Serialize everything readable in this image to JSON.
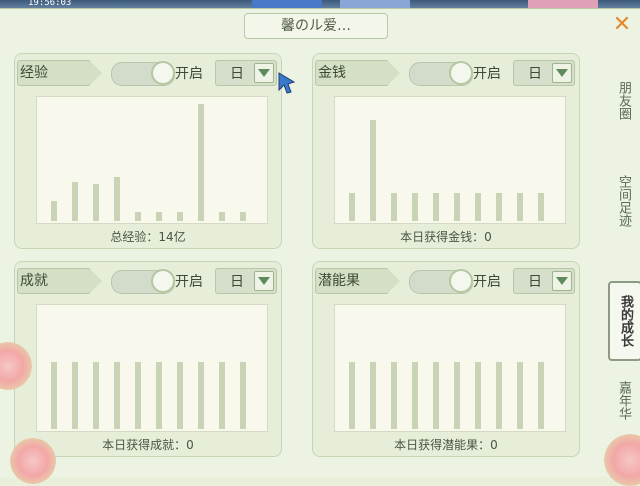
{
  "topbar": {
    "clock": "19:56:03"
  },
  "window": {
    "title": "馨のル爱…",
    "close": "✕"
  },
  "panels": [
    {
      "id": "exp",
      "label": "经验",
      "toggle": "开启",
      "select": "日",
      "summary": "总经验：14亿",
      "bars": [
        0.16,
        0.32,
        0.3,
        0.36,
        0.07,
        0.07,
        0.07,
        0.96,
        0.07,
        0.07
      ]
    },
    {
      "id": "money",
      "label": "金钱",
      "toggle": "开启",
      "select": "日",
      "summary": "本日获得金钱：0",
      "bars": [
        0.23,
        0.83,
        0.23,
        0.23,
        0.23,
        0.23,
        0.23,
        0.23,
        0.23,
        0.23
      ]
    },
    {
      "id": "achievement",
      "label": "成就",
      "toggle": "开启",
      "select": "日",
      "summary": "本日获得成就：0",
      "bars": [
        0.55,
        0.55,
        0.55,
        0.55,
        0.55,
        0.55,
        0.55,
        0.55,
        0.55,
        0.55
      ]
    },
    {
      "id": "potential",
      "label": "潜能果",
      "toggle": "开启",
      "select": "日",
      "summary": "本日获得潜能果：0",
      "bars": [
        0.55,
        0.55,
        0.55,
        0.55,
        0.55,
        0.55,
        0.55,
        0.55,
        0.55,
        0.55
      ]
    }
  ],
  "sidenav": [
    {
      "label": "朋友圈",
      "active": false
    },
    {
      "label": "空间足迹",
      "active": false
    },
    {
      "label": "我的成长",
      "active": true
    },
    {
      "label": "嘉年华",
      "active": false
    }
  ]
}
